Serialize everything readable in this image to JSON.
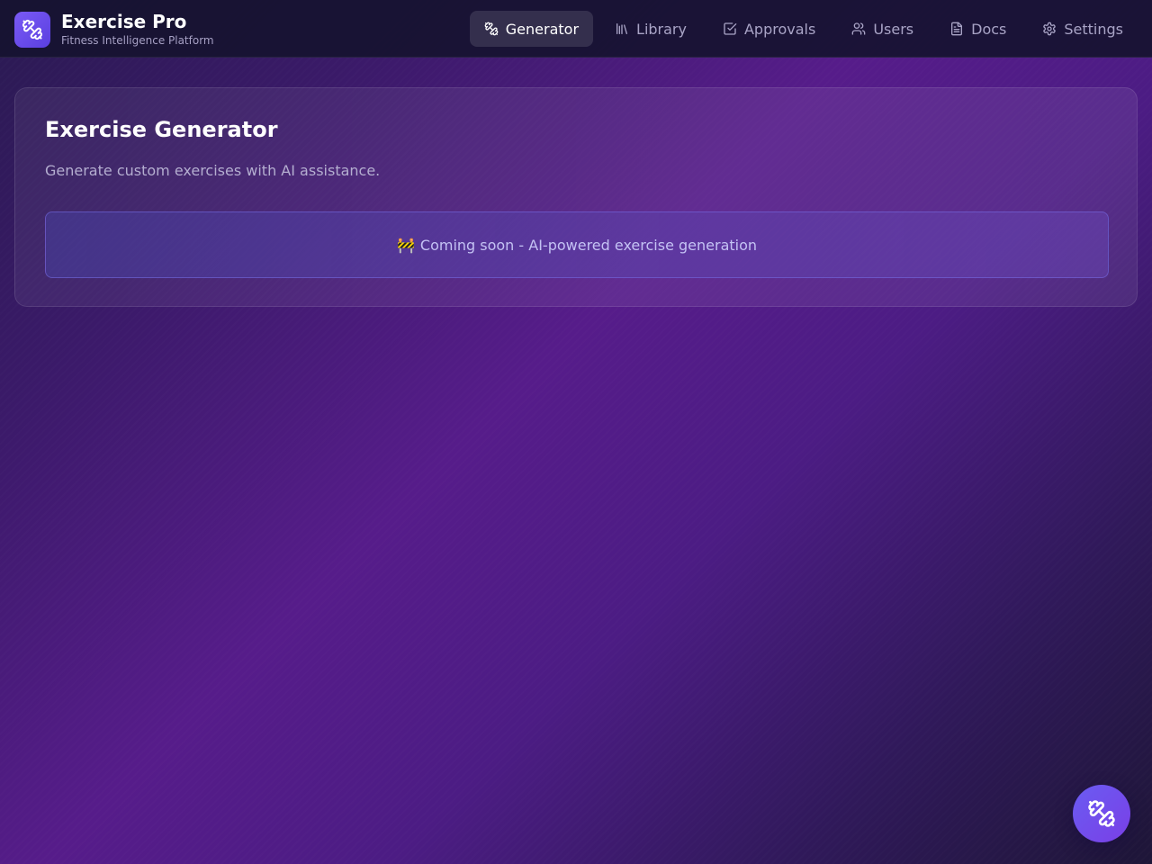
{
  "app": {
    "title": "Exercise Pro",
    "subtitle": "Fitness Intelligence Platform",
    "logo_icon": "dumbbell-icon"
  },
  "nav": {
    "items": [
      {
        "label": "Generator",
        "icon": "dumbbell-icon",
        "active": true
      },
      {
        "label": "Library",
        "icon": "library-icon",
        "active": false
      },
      {
        "label": "Approvals",
        "icon": "checkbox-icon",
        "active": false
      },
      {
        "label": "Users",
        "icon": "users-icon",
        "active": false
      },
      {
        "label": "Docs",
        "icon": "document-icon",
        "active": false
      },
      {
        "label": "Settings",
        "icon": "gear-icon",
        "active": false
      }
    ]
  },
  "main": {
    "title": "Exercise Generator",
    "description": "Generate custom exercises with AI assistance.",
    "notice": {
      "icon": "🚧",
      "text": "Coming soon - AI-powered exercise generation"
    }
  },
  "fab": {
    "icon": "dumbbell-icon"
  },
  "colors": {
    "accent": "#6a5cf2",
    "header_bg": "#161230",
    "notice_text": "#c4c2f4"
  }
}
